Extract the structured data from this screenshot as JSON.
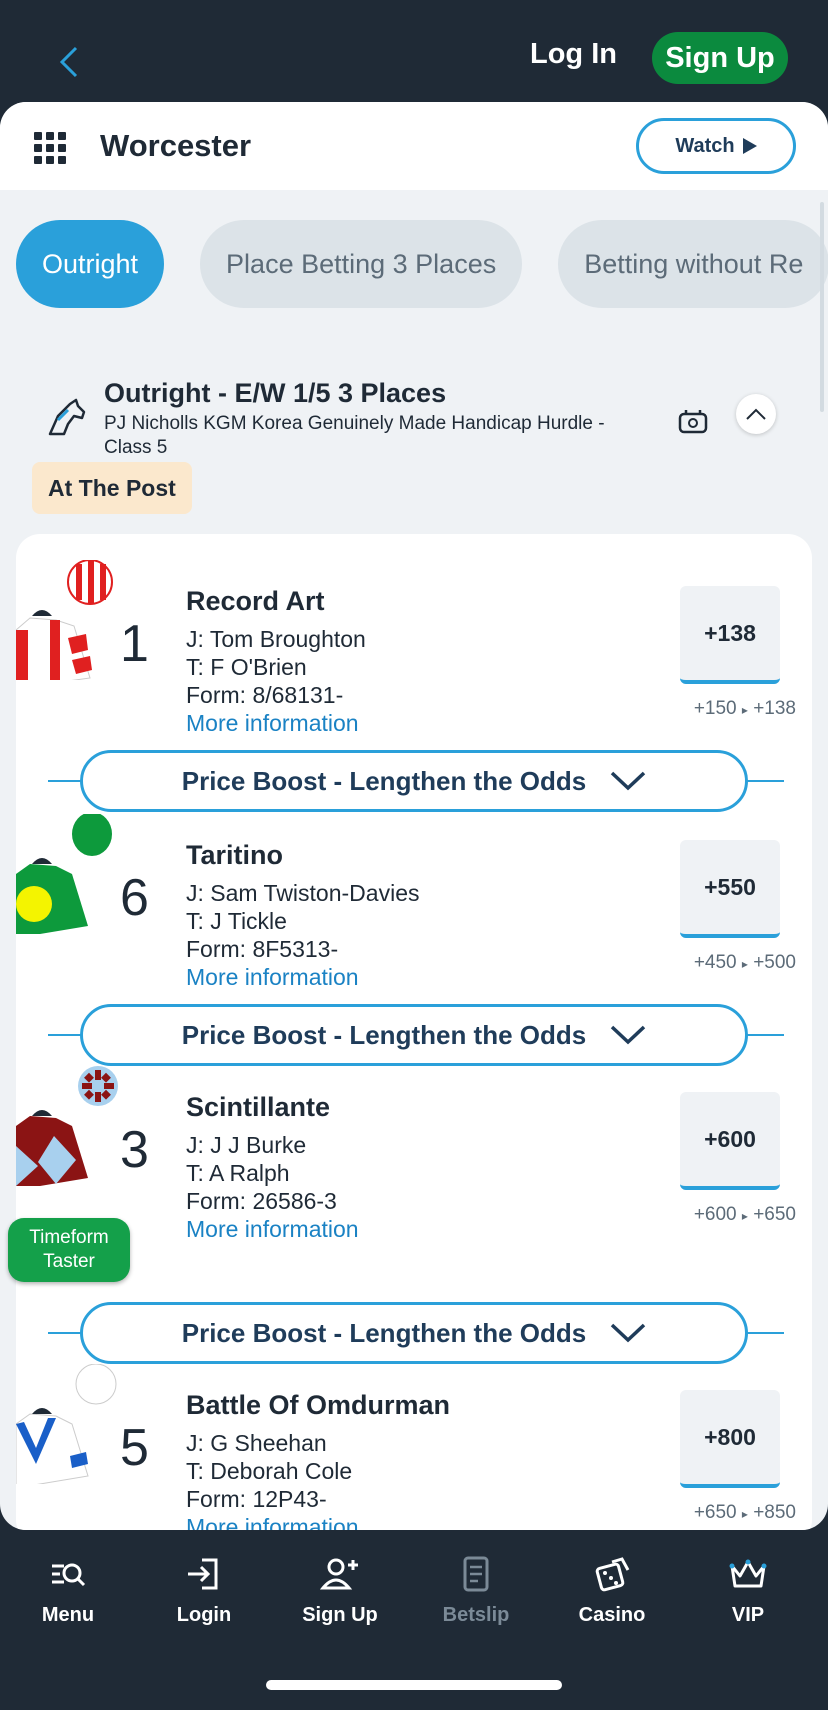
{
  "header": {
    "back_icon": "chevron-left-icon",
    "login_label": "Log In",
    "signup_label": "Sign Up"
  },
  "titlebar": {
    "menu_icon": "grid-icon",
    "title": "Worcester",
    "watch_label": "Watch",
    "watch_icon": "play-icon"
  },
  "tabs": [
    {
      "label": "Outright",
      "active": true
    },
    {
      "label": "Place Betting 3 Places",
      "active": false
    },
    {
      "label": "Betting without Re",
      "active": false
    }
  ],
  "race": {
    "title": "Outright - E/W 1/5 3 Places",
    "subtitle": "PJ Nicholls KGM Korea Genuinely Made Handicap Hurdle - Class 5",
    "status": "At The Post",
    "icons": [
      "horse-head-icon",
      "rules-icon",
      "chevron-up-icon"
    ]
  },
  "runners": [
    {
      "name": "Record Art",
      "number": "1",
      "jockey": "J: Tom Broughton",
      "trainer": "T: F O'Brien",
      "form": "Form:  8/68131-",
      "more": "More information",
      "odds": "+138",
      "previous": "+150",
      "current": "+138"
    },
    {
      "name": "Taritino",
      "number": "6",
      "jockey": "J: Sam Twiston-Davies",
      "trainer": "T: J Tickle",
      "form": "Form:  8F5313-",
      "more": "More information",
      "odds": "+550",
      "previous": "+450",
      "current": "+500"
    },
    {
      "name": "Scintillante",
      "number": "3",
      "jockey": "J: J J Burke",
      "trainer": "T: A Ralph",
      "form": "Form:  26586-3",
      "more": "More information",
      "odds": "+600",
      "previous": "+600",
      "current": "+650"
    },
    {
      "name": "Battle Of Omdurman",
      "number": "5",
      "jockey": "J: G Sheehan",
      "trainer": "T: Deborah Cole",
      "form": "Form:  12P43-",
      "more": "More information",
      "odds": "+800",
      "previous": "+650",
      "current": "+850"
    }
  ],
  "boost_label": "Price Boost - Lengthen the Odds",
  "taster_label": "Timeform Taster",
  "colors": {
    "accent": "#2aa0da",
    "brand_green": "#0b8a3e",
    "dark": "#1f2a36",
    "status_bg": "#fbe8cd"
  },
  "bottom_nav": [
    {
      "label": "Menu",
      "icon": "menu-search-icon",
      "enabled": true
    },
    {
      "label": "Login",
      "icon": "login-icon",
      "enabled": true
    },
    {
      "label": "Sign Up",
      "icon": "add-user-icon",
      "enabled": true
    },
    {
      "label": "Betslip",
      "icon": "betslip-icon",
      "enabled": false
    },
    {
      "label": "Casino",
      "icon": "dice-icon",
      "enabled": true
    },
    {
      "label": "VIP",
      "icon": "crown-icon",
      "enabled": true
    }
  ]
}
